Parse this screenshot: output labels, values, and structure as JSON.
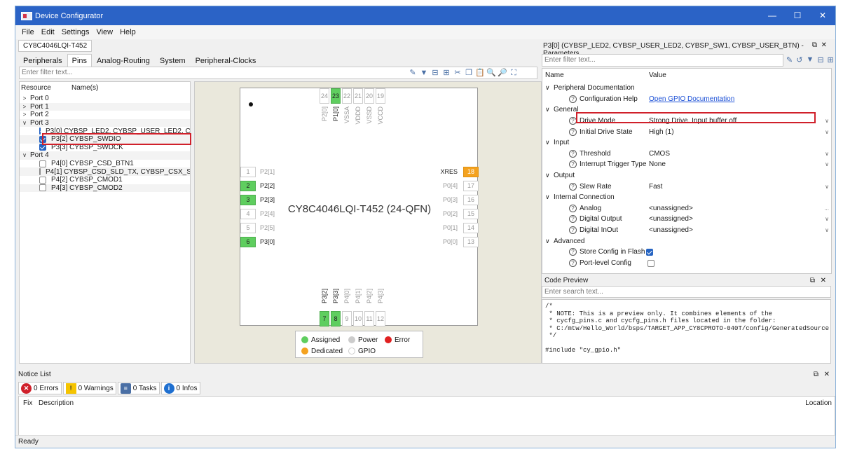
{
  "window": {
    "title": "Device Configurator",
    "minimize": "—",
    "maximize": "☐",
    "close": "✕"
  },
  "menu": [
    "File",
    "Edit",
    "Settings",
    "View",
    "Help"
  ],
  "device_tab": "CY8C4046LQI-T452",
  "tabs": [
    "Peripherals",
    "Pins",
    "Analog-Routing",
    "System",
    "Peripheral-Clocks"
  ],
  "left_filter_placeholder": "Enter filter text...",
  "tree": {
    "headers": [
      "Resource",
      "Name(s)"
    ],
    "rows": [
      {
        "exp": ">",
        "label": "Port 0",
        "indent": 0,
        "chk": null
      },
      {
        "exp": ">",
        "label": "Port 1",
        "indent": 0,
        "chk": null
      },
      {
        "exp": ">",
        "label": "Port 2",
        "indent": 0,
        "chk": null
      },
      {
        "exp": "∨",
        "label": "Port 3",
        "indent": 0,
        "chk": null
      },
      {
        "exp": "",
        "label": "P3[0]  CYBSP_LED2, CYBSP_USER_LED2, CYBS",
        "indent": 2,
        "chk": true
      },
      {
        "exp": "",
        "label": "P3[2]  CYBSP_SWDIO",
        "indent": 2,
        "chk": true
      },
      {
        "exp": "",
        "label": "P3[3]  CYBSP_SWDCK",
        "indent": 2,
        "chk": true
      },
      {
        "exp": "∨",
        "label": "Port 4",
        "indent": 0,
        "chk": null
      },
      {
        "exp": "",
        "label": "P4[0]  CYBSP_CSD_BTN1",
        "indent": 2,
        "chk": false
      },
      {
        "exp": "",
        "label": "P4[1]  CYBSP_CSD_SLD_TX, CYBSP_CSX_SLD_T",
        "indent": 2,
        "chk": false
      },
      {
        "exp": "",
        "label": "P4[2]  CYBSP_CMOD1",
        "indent": 2,
        "chk": false
      },
      {
        "exp": "",
        "label": "P4[3]  CYBSP_CMOD2",
        "indent": 2,
        "chk": false
      }
    ]
  },
  "chip": {
    "name": "CY8C4046LQI-T452 (24-QFN)",
    "top": [
      {
        "n": "24",
        "l": "P2[0]",
        "d": false
      },
      {
        "n": "23",
        "l": "P1[0]",
        "d": true
      },
      {
        "n": "22",
        "l": "VSSA",
        "d": false
      },
      {
        "n": "21",
        "l": "VDDD",
        "d": false
      },
      {
        "n": "20",
        "l": "VSSD",
        "d": false
      },
      {
        "n": "19",
        "l": "VCCD",
        "d": false
      }
    ],
    "left": [
      {
        "n": "1",
        "l": "P2[1]",
        "d": false
      },
      {
        "n": "2",
        "l": "P2[2]",
        "d": true
      },
      {
        "n": "3",
        "l": "P2[3]",
        "d": true
      },
      {
        "n": "4",
        "l": "P2[4]",
        "d": false
      },
      {
        "n": "5",
        "l": "P2[5]",
        "d": false
      },
      {
        "n": "6",
        "l": "P3[0]",
        "d": true
      }
    ],
    "right": [
      {
        "n": "18",
        "l": "XRES",
        "d": "o"
      },
      {
        "n": "17",
        "l": "P0[4]",
        "d": false
      },
      {
        "n": "16",
        "l": "P0[3]",
        "d": false
      },
      {
        "n": "15",
        "l": "P0[2]",
        "d": false
      },
      {
        "n": "14",
        "l": "P0[1]",
        "d": false
      },
      {
        "n": "13",
        "l": "P0[0]",
        "d": false
      }
    ],
    "bottom": [
      {
        "n": "7",
        "l": "P3[2]",
        "d": true
      },
      {
        "n": "8",
        "l": "P3[3]",
        "d": true
      },
      {
        "n": "9",
        "l": "P4[0]",
        "d": false
      },
      {
        "n": "10",
        "l": "P4[1]",
        "d": false
      },
      {
        "n": "11",
        "l": "P4[2]",
        "d": false
      },
      {
        "n": "12",
        "l": "P4[3]",
        "d": false
      }
    ]
  },
  "legend": {
    "assigned": "Assigned",
    "power": "Power",
    "error": "Error",
    "dedicated": "Dedicated",
    "gpio": "GPIO"
  },
  "params": {
    "title": "P3[0] (CYBSP_LED2, CYBSP_USER_LED2, CYBSP_SW1, CYBSP_USER_BTN) - Parameters",
    "filter_placeholder": "Enter filter text...",
    "headers": [
      "Name",
      "Value"
    ],
    "rows": [
      {
        "t": "s",
        "n": "Peripheral Documentation"
      },
      {
        "t": "p",
        "n": "Configuration Help",
        "v": "Open GPIO Documentation",
        "link": true
      },
      {
        "t": "s",
        "n": "General"
      },
      {
        "t": "p",
        "n": "Drive Mode",
        "v": "Strong Drive. Input buffer off",
        "dd": true
      },
      {
        "t": "p",
        "n": "Initial Drive State",
        "v": "High (1)",
        "dd": true
      },
      {
        "t": "s",
        "n": "Input"
      },
      {
        "t": "p",
        "n": "Threshold",
        "v": "CMOS",
        "dd": true
      },
      {
        "t": "p",
        "n": "Interrupt Trigger Type",
        "v": "None",
        "dd": true
      },
      {
        "t": "s",
        "n": "Output"
      },
      {
        "t": "p",
        "n": "Slew Rate",
        "v": "Fast",
        "dd": true
      },
      {
        "t": "s",
        "n": "Internal Connection"
      },
      {
        "t": "p",
        "n": "Analog",
        "v": "<unassigned>",
        "dots": true
      },
      {
        "t": "p",
        "n": "Digital Output",
        "v": "<unassigned>",
        "dd": true
      },
      {
        "t": "p",
        "n": "Digital InOut",
        "v": "<unassigned>",
        "dd": true
      },
      {
        "t": "s",
        "n": "Advanced"
      },
      {
        "t": "p",
        "n": "Store Config in Flash",
        "cb": true
      },
      {
        "t": "p",
        "n": "Port-level Config",
        "cb": false
      }
    ]
  },
  "code": {
    "title": "Code Preview",
    "search_placeholder": "Enter search text...",
    "text": "/*\n * NOTE: This is a preview only. It combines elements of the\n * cycfg_pins.c and cycfg_pins.h files located in the folder:\n * C:/mtw/Hello_World/bsps/TARGET_APP_CY8CPROTO-040T/config/GeneratedSource\n */\n\n#include \"cy_gpio.h\""
  },
  "notice": {
    "title": "Notice List",
    "errors": "0 Errors",
    "warnings": "0 Warnings",
    "tasks": "0 Tasks",
    "infos": "0 Infos",
    "col_fix": "Fix",
    "col_desc": "Description",
    "col_loc": "Location"
  },
  "status": "Ready"
}
